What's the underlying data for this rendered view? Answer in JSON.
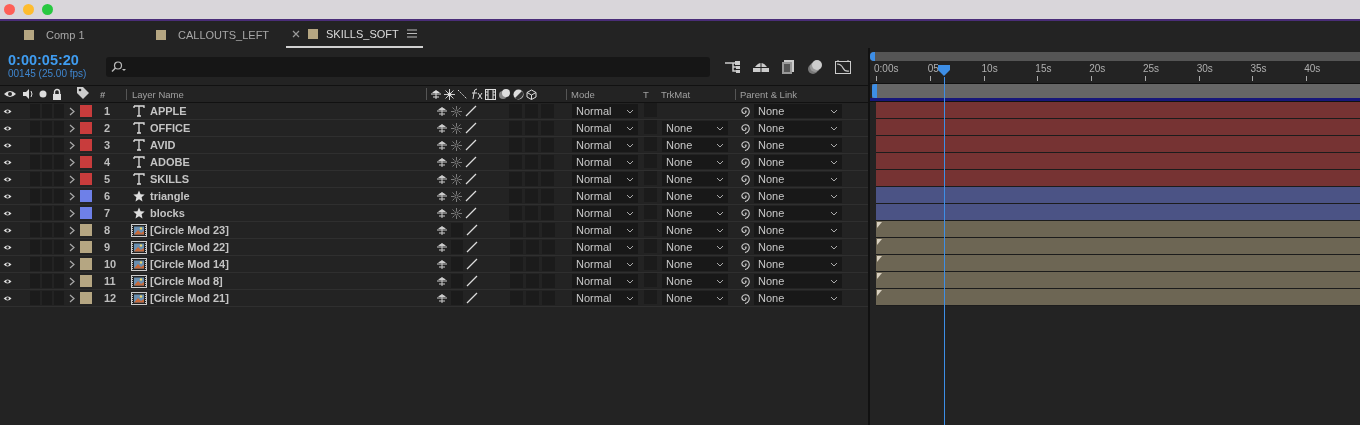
{
  "tabs": [
    {
      "label": "Comp 1",
      "color": "#b5a682",
      "selected": false
    },
    {
      "label": "CALLOUTS_LEFT",
      "color": "#b5a682",
      "selected": false
    },
    {
      "label": "SKILLS_SOFT",
      "color": "#b5a682",
      "selected": true
    }
  ],
  "timecode": {
    "time": "0:00:05:20",
    "frames": "00145 (25.00 fps)"
  },
  "columns": {
    "number": "#",
    "layer_name": "Layer Name",
    "mode": "Mode",
    "t": "T",
    "trkmat": "TrkMat",
    "parent": "Parent & Link"
  },
  "layers": [
    {
      "number": "1",
      "kind": "text",
      "name": "APPLE",
      "color": "#c83c3c",
      "mode": "Normal",
      "parent": "None"
    },
    {
      "number": "2",
      "kind": "text",
      "name": "OFFICE",
      "color": "#c83c3c",
      "mode": "Normal",
      "trkmat": "None",
      "parent": "None"
    },
    {
      "number": "3",
      "kind": "text",
      "name": "AVID",
      "color": "#c83c3c",
      "mode": "Normal",
      "trkmat": "None",
      "parent": "None"
    },
    {
      "number": "4",
      "kind": "text",
      "name": "ADOBE",
      "color": "#c83c3c",
      "mode": "Normal",
      "trkmat": "None",
      "parent": "None"
    },
    {
      "number": "5",
      "kind": "text",
      "name": "SKILLS",
      "color": "#c83c3c",
      "mode": "Normal",
      "trkmat": "None",
      "parent": "None"
    },
    {
      "number": "6",
      "kind": "shape",
      "name": "triangle",
      "color": "#6e80e8",
      "mode": "Normal",
      "trkmat": "None",
      "parent": "None"
    },
    {
      "number": "7",
      "kind": "shape",
      "name": "blocks",
      "color": "#6e80e8",
      "mode": "Normal",
      "trkmat": "None",
      "parent": "None"
    },
    {
      "number": "8",
      "kind": "footage",
      "name": "[Circle Mod 23]",
      "color": "#b5a682",
      "mode": "Normal",
      "trkmat": "None",
      "parent": "None"
    },
    {
      "number": "9",
      "kind": "footage",
      "name": "[Circle Mod 22]",
      "color": "#b5a682",
      "mode": "Normal",
      "trkmat": "None",
      "parent": "None"
    },
    {
      "number": "10",
      "kind": "footage",
      "name": "[Circle Mod 14]",
      "color": "#b5a682",
      "mode": "Normal",
      "trkmat": "None",
      "parent": "None"
    },
    {
      "number": "11",
      "kind": "footage",
      "name": "[Circle Mod 8]",
      "color": "#b5a682",
      "mode": "Normal",
      "trkmat": "None",
      "parent": "None"
    },
    {
      "number": "12",
      "kind": "footage",
      "name": "[Circle Mod 21]",
      "color": "#b5a682",
      "mode": "Normal",
      "trkmat": "None",
      "parent": "None"
    }
  ],
  "ruler": [
    "0:00s",
    "05",
    "10s",
    "15s",
    "20s",
    "25s",
    "30s",
    "35s",
    "40s"
  ]
}
